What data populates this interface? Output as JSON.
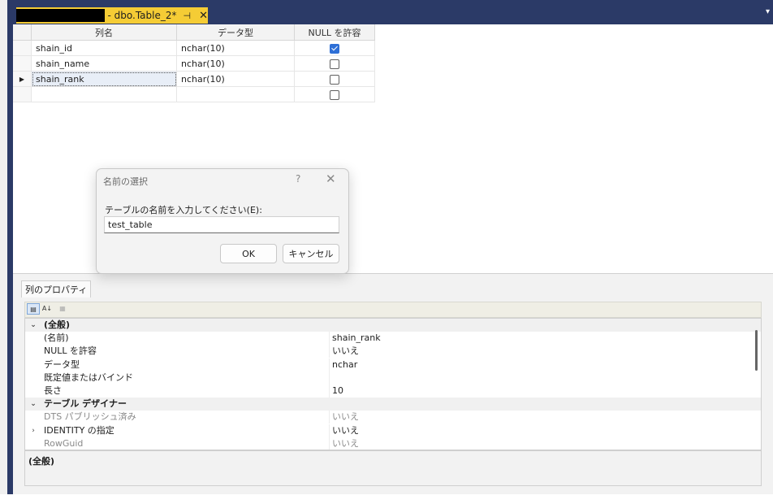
{
  "tab": {
    "title": "- dbo.Table_2*",
    "pin_glyph": "⊣",
    "close_glyph": "✕"
  },
  "grid": {
    "headers": [
      "列名",
      "データ型",
      "NULL を許容"
    ],
    "rows": [
      {
        "name": "shain_id",
        "type": "nchar(10)",
        "allow_null": true
      },
      {
        "name": "shain_name",
        "type": "nchar(10)",
        "allow_null": false
      },
      {
        "name": "shain_rank",
        "type": "nchar(10)",
        "allow_null": false
      },
      {
        "name": "",
        "type": "",
        "allow_null": false
      }
    ],
    "current_row_glyph": "▶"
  },
  "dialog": {
    "title": "名前の選択",
    "help_glyph": "?",
    "close_glyph": "✕",
    "prompt": "テーブルの名前を入力してください(E):",
    "input_value": "test_table",
    "ok_label": "OK",
    "cancel_label": "キャンセル"
  },
  "props": {
    "tab_label": "列のプロパティ",
    "rows": [
      {
        "kind": "cat",
        "exp": "⌄",
        "name": "(全般)",
        "value": ""
      },
      {
        "kind": "item",
        "exp": "",
        "name": "(名前)",
        "value": "shain_rank"
      },
      {
        "kind": "item",
        "exp": "",
        "name": "NULL を許容",
        "value": "いいえ"
      },
      {
        "kind": "item",
        "exp": "",
        "name": "データ型",
        "value": "nchar"
      },
      {
        "kind": "item",
        "exp": "",
        "name": "既定値またはバインド",
        "value": ""
      },
      {
        "kind": "item",
        "exp": "",
        "name": "長さ",
        "value": "10"
      },
      {
        "kind": "cat",
        "exp": "⌄",
        "name": "テーブル デザイナー",
        "value": ""
      },
      {
        "kind": "dim",
        "exp": "",
        "name": "DTS パブリッシュ済み",
        "value": "いいえ"
      },
      {
        "kind": "item",
        "exp": "›",
        "name": "IDENTITY の指定",
        "value": "いいえ"
      },
      {
        "kind": "dim",
        "exp": "",
        "name": "RowGuid",
        "value": "いいえ"
      }
    ],
    "description_title": "(全般)"
  }
}
